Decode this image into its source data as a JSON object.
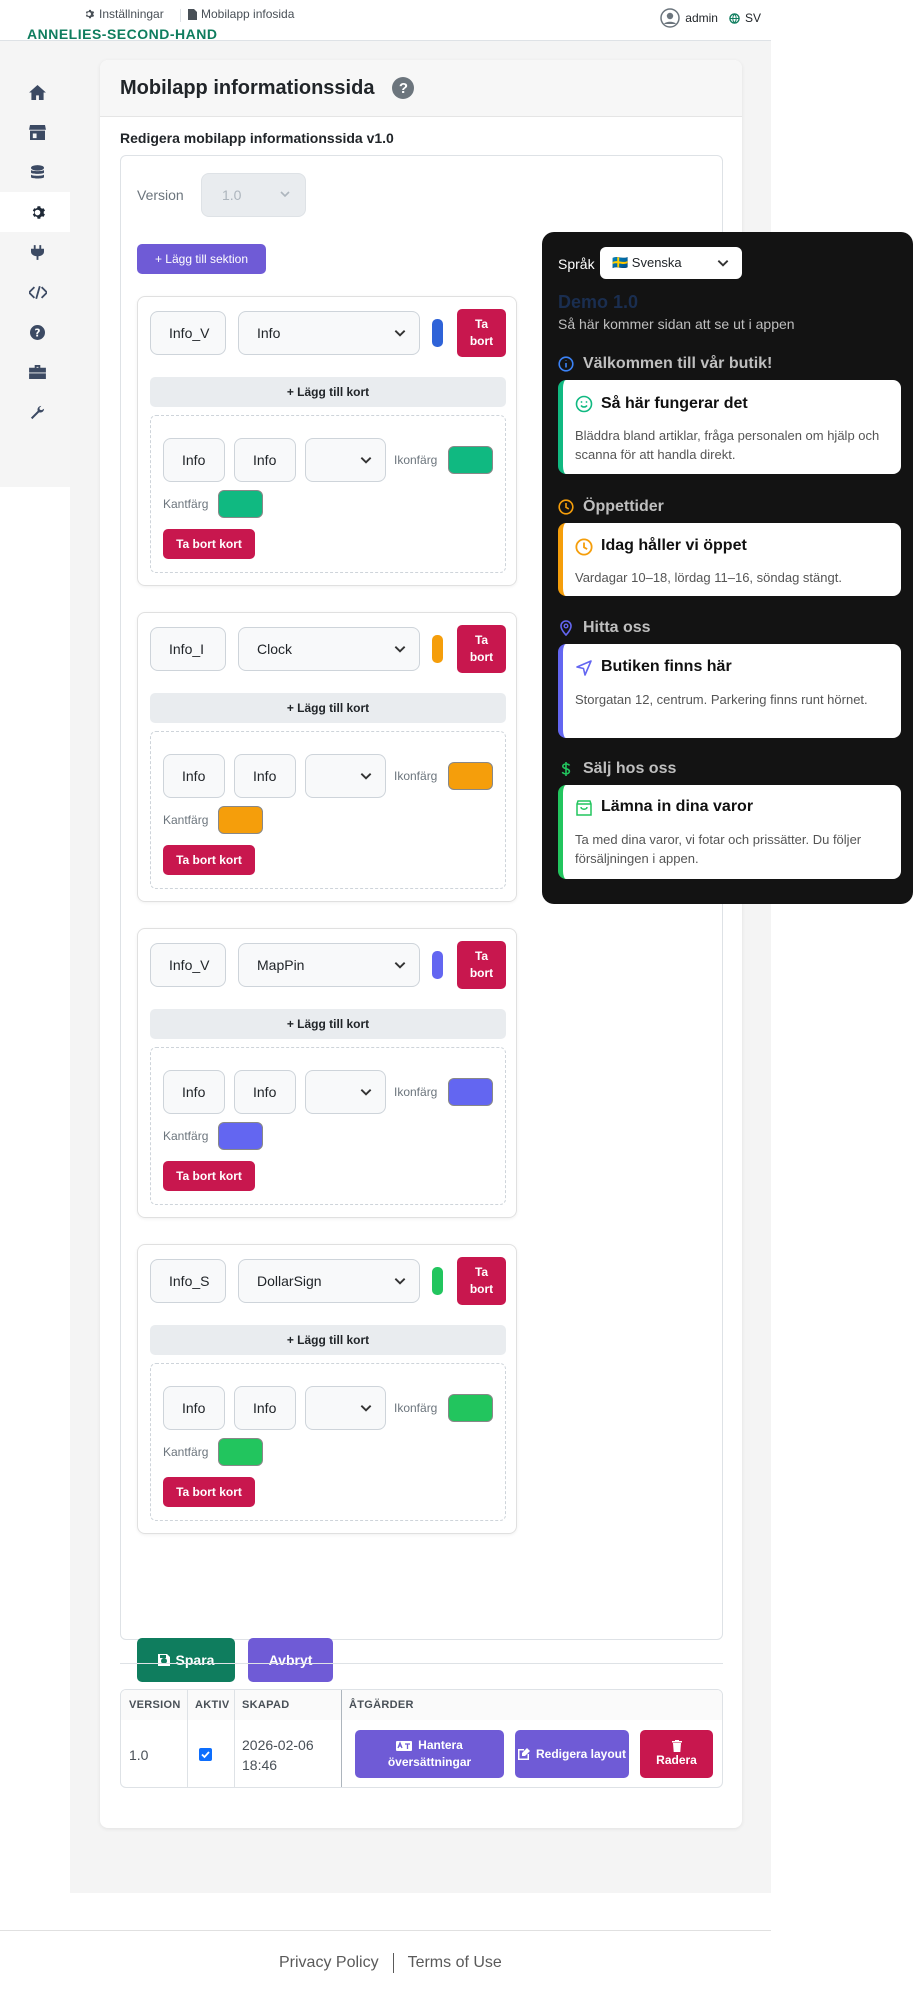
{
  "header": {
    "brand": "ANNELIES-SECOND-HAND",
    "breadcrumb": [
      {
        "label": "Inställningar",
        "icon": "gear-icon"
      },
      {
        "label": "Mobilapp infosida",
        "icon": "document-icon"
      }
    ],
    "user": "admin",
    "language": "SV"
  },
  "sidebar": {
    "items": [
      {
        "icon": "home-icon"
      },
      {
        "icon": "store-icon"
      },
      {
        "icon": "database-icon"
      },
      {
        "icon": "gear-icon",
        "active": true
      },
      {
        "icon": "plug-icon"
      },
      {
        "icon": "code-icon"
      },
      {
        "icon": "question-circle-icon"
      },
      {
        "icon": "toolbox-icon"
      },
      {
        "icon": "wrench-icon"
      }
    ]
  },
  "page": {
    "title": "Mobilapp informationssida",
    "subtitle": "Redigera mobilapp informationssida v1.0",
    "version_label": "Version",
    "version_value": "1.0",
    "add_section": "+ Lägg till sektion",
    "add_card": "+ Lägg till kort",
    "delete_section": "Ta bort",
    "delete_card": "Ta bort kort",
    "icon_color_label": "Ikonfärg",
    "border_color_label": "Kantfärg",
    "save": "Spara",
    "cancel": "Avbryt"
  },
  "sections": [
    {
      "key": "Info_V",
      "icon": "Info",
      "color": "#2f63d8",
      "card_title": "Info",
      "card_text": "Info",
      "card_icon_color": "#10b981",
      "card_border_color": "#10b981"
    },
    {
      "key": "Info_I",
      "icon": "Clock",
      "color": "#f59e0b",
      "card_title": "Info",
      "card_text": "Info",
      "card_icon_color": "#f59e0b",
      "card_border_color": "#f59e0b"
    },
    {
      "key": "Info_V",
      "icon": "MapPin",
      "color": "#6366f1",
      "card_title": "Info",
      "card_text": "Info",
      "card_icon_color": "#6366f1",
      "card_border_color": "#6366f1"
    },
    {
      "key": "Info_S",
      "icon": "DollarSign",
      "color": "#22c55e",
      "card_title": "Info",
      "card_text": "Info",
      "card_icon_color": "#22c55e",
      "card_border_color": "#22c55e"
    }
  ],
  "versions_table": {
    "headers": [
      "VERSION",
      "AKTIV",
      "SKAPAD",
      "ÅTGÄRDER"
    ],
    "rows": [
      {
        "version": "1.0",
        "active": true,
        "created_line1": "2026-02-06",
        "created_line2": "18:46"
      }
    ],
    "actions": {
      "translations": "Hantera översättningar",
      "layout": "Redigera layout",
      "delete": "Radera"
    }
  },
  "preview": {
    "language_label": "Språk",
    "language_value": "🇸🇪 Svenska",
    "demo_title": "Demo 1.0",
    "demo_subtitle": "Så här kommer sidan att se ut i appen",
    "sections": [
      {
        "title": "Välkommen till vår butik!",
        "section_icon": "info-icon",
        "color": "#3b82f6",
        "card_title": "Så här fungerar det",
        "card_icon": "smile-icon",
        "card_color": "#10b981",
        "card_text": "Bläddra bland artiklar, fråga personalen om hjälp och scanna för att handla direkt."
      },
      {
        "title": "Öppettider",
        "section_icon": "clock-icon",
        "color": "#f59e0b",
        "card_title": "Idag håller vi öppet",
        "card_icon": "clock-icon",
        "card_color": "#f59e0b",
        "card_text": "Vardagar 10–18, lördag 11–16, söndag stängt."
      },
      {
        "title": "Hitta oss",
        "section_icon": "map-pin-icon",
        "color": "#6366f1",
        "card_title": "Butiken finns här",
        "card_icon": "navigation-icon",
        "card_color": "#6366f1",
        "card_text": "Storgatan 12, centrum. Parkering finns runt hörnet."
      },
      {
        "title": "Sälj hos oss",
        "section_icon": "dollar-icon",
        "color": "#22c55e",
        "card_title": "Lämna in dina varor",
        "card_icon": "bag-icon",
        "card_color": "#22c55e",
        "card_text": "Ta med dina varor, vi fotar och prissätter. Du följer försäljningen i appen."
      }
    ]
  },
  "footer": {
    "privacy": "Privacy Policy",
    "terms": "Terms of Use"
  }
}
